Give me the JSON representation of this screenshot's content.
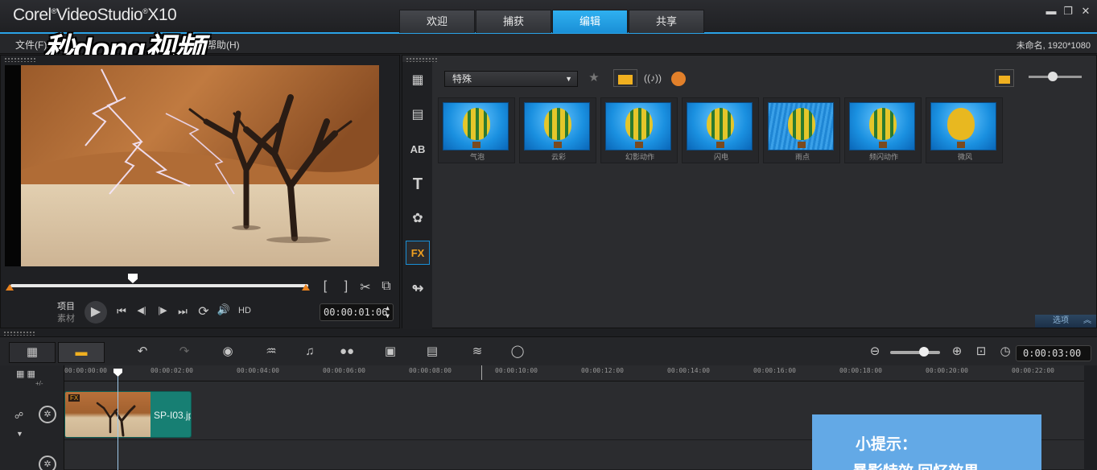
{
  "app": {
    "title_prefix": "Corel",
    "title_main": "VideoStudio",
    "title_version": "X10",
    "watermark": "秒dong视频"
  },
  "main_tabs": [
    {
      "label": "欢迎",
      "active": false
    },
    {
      "label": "捕获",
      "active": false
    },
    {
      "label": "编辑",
      "active": true
    },
    {
      "label": "共享",
      "active": false
    }
  ],
  "window_controls": {
    "minimize": "▬",
    "restore": "❐",
    "close": "✕"
  },
  "menu": {
    "file": "文件(F)",
    "help": "帮助(H)"
  },
  "project_info": "未命名, 1920*1080",
  "preview": {
    "mode_project": "项目",
    "mode_clip": "素材",
    "hd_label": "HD",
    "timecode": "00:00:01:06",
    "controls": {
      "mark_in": "[",
      "mark_out": "]",
      "split": "✂",
      "enlarge": "⧉",
      "play": "▶",
      "home": "⏮",
      "prev": "◀|",
      "next": "|▶",
      "end": "⏭",
      "repeat": "⟳",
      "volume": "🔊"
    }
  },
  "library": {
    "category": "特殊",
    "sidebar_icons": [
      {
        "name": "media-icon",
        "glyph": "▦"
      },
      {
        "name": "instant-project-icon",
        "glyph": "▤"
      },
      {
        "name": "transition-icon",
        "glyph": "AB"
      },
      {
        "name": "title-icon",
        "glyph": "T"
      },
      {
        "name": "graphic-icon",
        "glyph": "✿"
      },
      {
        "name": "filter-icon",
        "glyph": "FX"
      },
      {
        "name": "path-icon",
        "glyph": "↬"
      }
    ],
    "thumbnails": [
      {
        "label": "气泡"
      },
      {
        "label": "云彩"
      },
      {
        "label": "幻影动作"
      },
      {
        "label": "闪电"
      },
      {
        "label": "雨点"
      },
      {
        "label": "频闪动作"
      },
      {
        "label": "微风"
      }
    ],
    "options_label": "选项"
  },
  "timeline": {
    "project_duration": "0:00:03:00",
    "ruler_labels": [
      "00:00:00:00",
      "00:00:02:00",
      "00:00:04:00",
      "00:00:06:00",
      "00:00:08:00",
      "00:00:10:00",
      "00:00:12:00",
      "00:00:14:00",
      "00:00:16:00",
      "00:00:18:00",
      "00:00:20:00",
      "00:00:22:00"
    ],
    "clip": {
      "label": "SP-I03.jp",
      "badge": "FX"
    },
    "track_add_label": "+/-"
  },
  "tip": {
    "title": "小提示：",
    "text": "暴影特效 回忆效果"
  },
  "colors": {
    "accent": "#2aa3e8",
    "clip": "#177f73",
    "trim": "#e8821e",
    "tip": "#63a9e6"
  }
}
